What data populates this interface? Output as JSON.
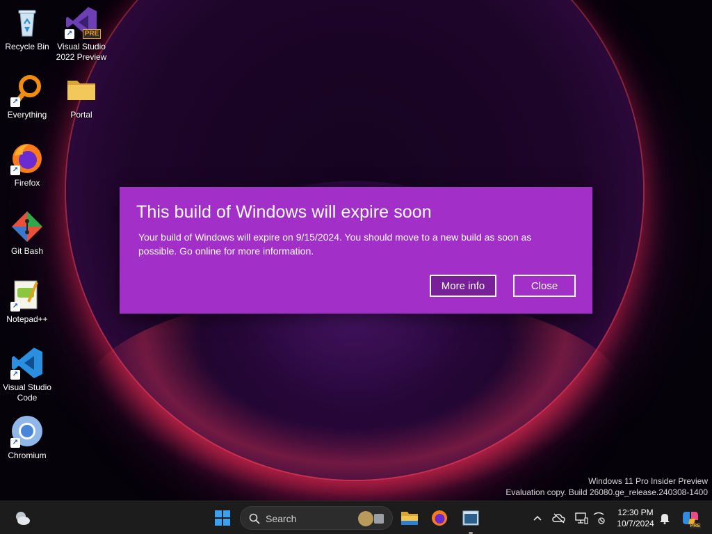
{
  "desktop": {
    "icons": [
      {
        "label": "Recycle Bin",
        "icon": "recycle-bin-icon"
      },
      {
        "label": "Visual Studio 2022 Preview",
        "icon": "visual-studio-icon",
        "badge": "PRE"
      },
      {
        "label": "Everything",
        "icon": "everything-icon"
      },
      {
        "label": "Portal",
        "icon": "folder-icon"
      },
      {
        "label": "Firefox",
        "icon": "firefox-icon"
      },
      {
        "label": "Git Bash",
        "icon": "git-bash-icon"
      },
      {
        "label": "Notepad++",
        "icon": "notepad-plus-plus-icon"
      },
      {
        "label": "Visual Studio Code",
        "icon": "vscode-icon"
      },
      {
        "label": "Chromium",
        "icon": "chromium-icon"
      }
    ],
    "shortcut_arrow": "↗"
  },
  "dialog": {
    "title": "This build of Windows will expire soon",
    "body": "Your build of Windows will expire on 9/15/2024. You should move to a new build as soon as possible. Go online for more information.",
    "more_info_label": "More info",
    "close_label": "Close",
    "background_color": "#a230c8"
  },
  "watermark": {
    "line1": "Windows 11 Pro Insider Preview",
    "line2": "Evaluation copy. Build 26080.ge_release.240308-1400"
  },
  "taskbar": {
    "search_placeholder": "Search",
    "clock_time": "12:30 PM",
    "clock_date": "10/7/2024",
    "pinned": [
      "file-explorer-icon",
      "firefox-icon",
      "terminal-icon"
    ],
    "tray": [
      "chevron-up-icon",
      "onedrive-icon",
      "display-icon",
      "network-icon",
      "notification-bell-icon",
      "copilot-icon"
    ],
    "copilot_badge": "PRE"
  }
}
